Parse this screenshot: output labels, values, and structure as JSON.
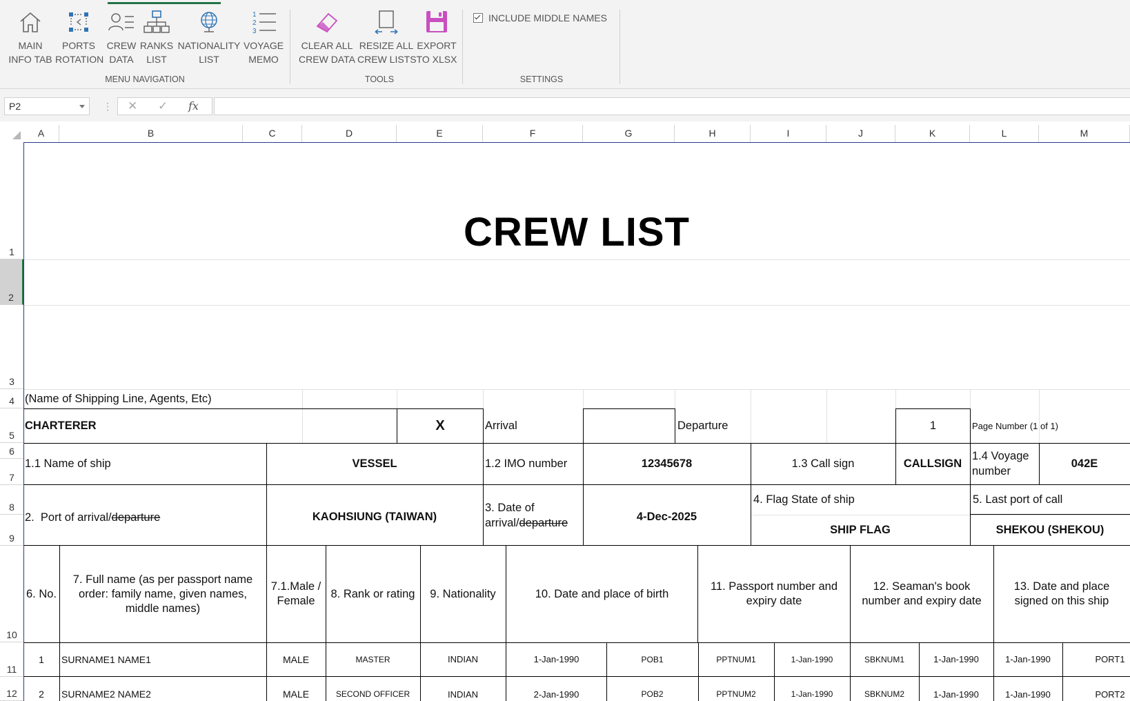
{
  "ribbon": {
    "buttons": [
      {
        "id": "main-info-tab",
        "label": "MAIN\nINFO TAB"
      },
      {
        "id": "ports-rotation",
        "label": "PORTS\nROTATION"
      },
      {
        "id": "crew-data",
        "label": "CREW\nDATA"
      },
      {
        "id": "ranks-list",
        "label": "RANKS\nLIST"
      },
      {
        "id": "nationality-list",
        "label": "NATIONALITY\nLIST"
      },
      {
        "id": "voyage-memo",
        "label": "VOYAGE\nMEMO"
      },
      {
        "id": "clear-all-crew-data",
        "label": "CLEAR ALL\nCREW DATA"
      },
      {
        "id": "resize-all-crew-lists",
        "label": "RESIZE ALL\nCREW LISTS"
      },
      {
        "id": "export-to-xlsx",
        "label": "EXPORT\nTO XLSX"
      }
    ],
    "groups": {
      "menu_navigation": "MENU NAVIGATION",
      "tools": "TOOLS",
      "settings": "SETTINGS"
    },
    "include_middle_names": {
      "label": "INCLUDE MIDDLE NAMES",
      "checked": true
    },
    "colors": {
      "accent": "#217346",
      "clear_icon": "#c94fc0",
      "export_icon": "#c94fc0",
      "nav_icon": "#2f74b5"
    }
  },
  "formula_bar": {
    "name_box": "P2",
    "cancel_icon": "✕",
    "enter_icon": "✓",
    "fx": "fx",
    "value": ""
  },
  "columns": [
    "A",
    "B",
    "C",
    "D",
    "E",
    "F",
    "G",
    "H",
    "I",
    "J",
    "K",
    "L",
    "M"
  ],
  "rows": [
    "1",
    "2",
    "3",
    "4",
    "5",
    "6",
    "7",
    "8",
    "9",
    "10",
    "11",
    "12"
  ],
  "selected_row": "2",
  "sheet": {
    "title": "CREW LIST",
    "shipping_line": "(Name of Shipping Line, Agents, Etc)",
    "charterer": "CHARTERER",
    "arrival_mark": "X",
    "arrival": "Arrival",
    "departure": "Departure",
    "page_index": "1",
    "page_number": "Page Number (1 of 1)",
    "name_of_ship_label": "1.1 Name of ship",
    "name_of_ship": "VESSEL",
    "imo_label": "1.2 IMO number",
    "imo": "12345678",
    "call_sign_label": "1.3 Call sign",
    "call_sign": "CALLSIGN",
    "voyage_label": "1.4 Voyage number",
    "voyage": "042E",
    "port_label_a": "2.  Port of arrival/",
    "port_label_b": "departure",
    "port": "KAOHSIUNG (TAIWAN)",
    "date_label_a": "3. Date of arrival/",
    "date_label_b": "departure",
    "date": "4-Dec-2025",
    "flag_label": "4. Flag State of ship",
    "flag": "SHIP FLAG",
    "last_port_label": "5. Last port of call",
    "last_port": "SHEKOU (SHEKOU)",
    "headers": {
      "no": "6. No.",
      "full_name": "7. Full name (as per passport name order: family name, given names, middle names)",
      "sex": "7.1.Male / Female",
      "rank": "8. Rank or rating",
      "nationality": "9. Nationality",
      "birth": "10. Date and place of birth",
      "passport": "11. Passport number and expiry date",
      "seamans_book": "12. Seaman's book number and expiry date",
      "signed_on": "13. Date and place signed on this ship"
    },
    "crew": [
      {
        "no": "1",
        "name": "SURNAME1 NAME1",
        "sex": "MALE",
        "rank": "MASTER",
        "nationality": "INDIAN",
        "dob": "1-Jan-1990",
        "pob": "POB1",
        "passport": "PPTNUM1",
        "passport_exp": "1-Jan-1990",
        "sbk": "SBKNUM1",
        "sbk_exp": "1-Jan-1990",
        "signed_date": "1-Jan-1990",
        "signed_port": "PORT1"
      },
      {
        "no": "2",
        "name": "SURNAME2 NAME2",
        "sex": "MALE",
        "rank": "SECOND OFFICER",
        "nationality": "INDIAN",
        "dob": "2-Jan-1990",
        "pob": "POB2",
        "passport": "PPTNUM2",
        "passport_exp": "1-Jan-1990",
        "sbk": "SBKNUM2",
        "sbk_exp": "1-Jan-1990",
        "signed_date": "1-Jan-1990",
        "signed_port": "PORT2"
      }
    ]
  }
}
